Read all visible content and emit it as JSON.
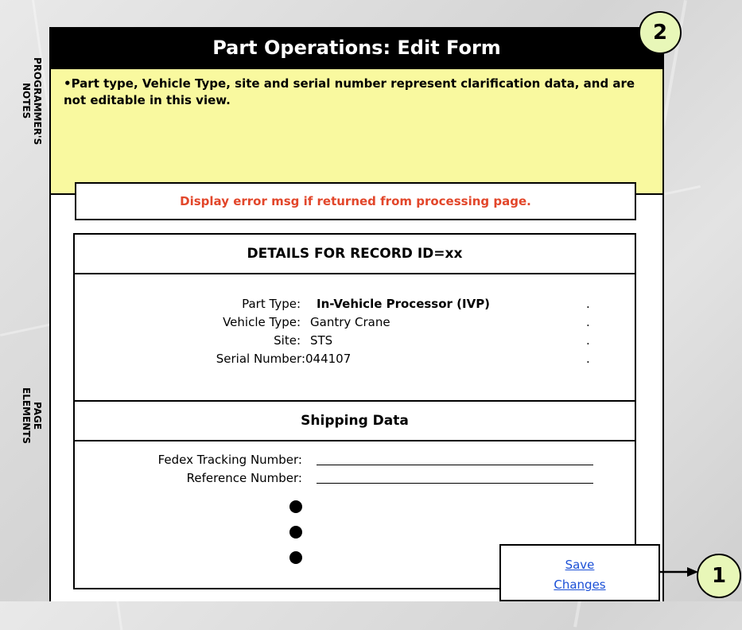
{
  "side_labels": {
    "programmer_notes": "PROGRAMMER'S\nNOTES",
    "page_elements": "PAGE\nELEMENTS"
  },
  "header": {
    "title": "Part Operations: Edit Form"
  },
  "notes": {
    "text": "•Part type, Vehicle Type, site and serial number represent clarification data, and are not editable in this view."
  },
  "error_message": "Display error msg if returned from processing page.",
  "details": {
    "header": "DETAILS FOR RECORD ID=xx",
    "fields": [
      {
        "label": "Part Type:",
        "value": "In-Vehicle Processor (IVP)",
        "dot": "."
      },
      {
        "label": "Vehicle Type:",
        "value": "Gantry Crane",
        "dot": "."
      },
      {
        "label": "Site:",
        "value": "STS",
        "dot": "."
      },
      {
        "label": "Serial Number:",
        "value": "044107",
        "dot": "."
      }
    ]
  },
  "shipping": {
    "header": "Shipping Data",
    "fields": [
      {
        "label": "Fedex Tracking Number:",
        "value": ""
      },
      {
        "label": "Reference Number:",
        "value": ""
      }
    ]
  },
  "save": {
    "line1": "Save",
    "line2": "Changes"
  },
  "badges": {
    "badge_1": "1",
    "badge_2": "2"
  },
  "colors": {
    "accent_notes": "#f9f99f",
    "error_text": "#e2462a",
    "link": "#1a4fd6",
    "badge_fill": "#e8f7b8"
  }
}
